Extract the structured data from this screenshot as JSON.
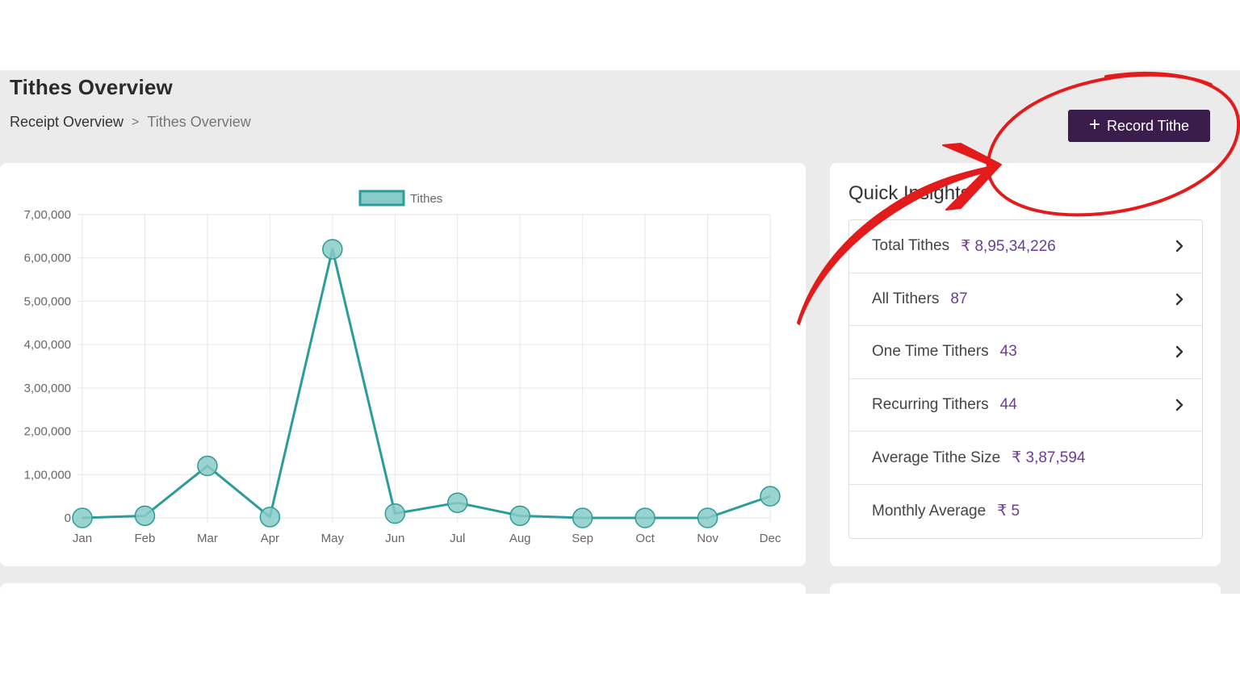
{
  "header": {
    "title": "Tithes Overview",
    "breadcrumb": {
      "parent": "Receipt Overview",
      "separator": ">",
      "current": "Tithes Overview"
    },
    "record_button": {
      "icon": "plus-icon",
      "label": "Record Tithe"
    }
  },
  "chart_data": {
    "type": "line",
    "categories": [
      "Jan",
      "Feb",
      "Mar",
      "Apr",
      "May",
      "Jun",
      "Jul",
      "Aug",
      "Sep",
      "Oct",
      "Nov",
      "Dec"
    ],
    "series": [
      {
        "name": "Tithes",
        "values": [
          0,
          5000,
          120000,
          2000,
          620000,
          10000,
          35000,
          5000,
          0,
          0,
          0,
          50000
        ]
      }
    ],
    "yticks": [
      "0",
      "1,00,000",
      "2,00,000",
      "3,00,000",
      "4,00,000",
      "5,00,000",
      "6,00,000",
      "7,00,000"
    ],
    "ylim": [
      0,
      700000
    ],
    "legend": "top-center",
    "grid": true,
    "colors": {
      "line": "#2a9d9a",
      "point_fill": "#88cbc7"
    }
  },
  "insights": {
    "title": "Quick Insights",
    "items": [
      {
        "label": "Total Tithes",
        "value": "₹ 8,95,34,226",
        "has_arrow": true
      },
      {
        "label": "All Tithers",
        "value": "87",
        "has_arrow": true
      },
      {
        "label": "One Time Tithers",
        "value": "43",
        "has_arrow": true
      },
      {
        "label": "Recurring Tithers",
        "value": "44",
        "has_arrow": true
      },
      {
        "label": "Average Tithe Size",
        "value": "₹ 3,87,594",
        "has_arrow": false
      },
      {
        "label": "Monthly Average",
        "value": "₹ 5",
        "has_arrow": false
      }
    ]
  },
  "annotation": {
    "color": "#e31b1b",
    "shapes": [
      "red-circle-annotation",
      "red-arrow-annotation"
    ]
  },
  "colors": {
    "accent": "#3a1d4a",
    "value_text": "#6a3d9a",
    "background": "#ebebeb"
  }
}
